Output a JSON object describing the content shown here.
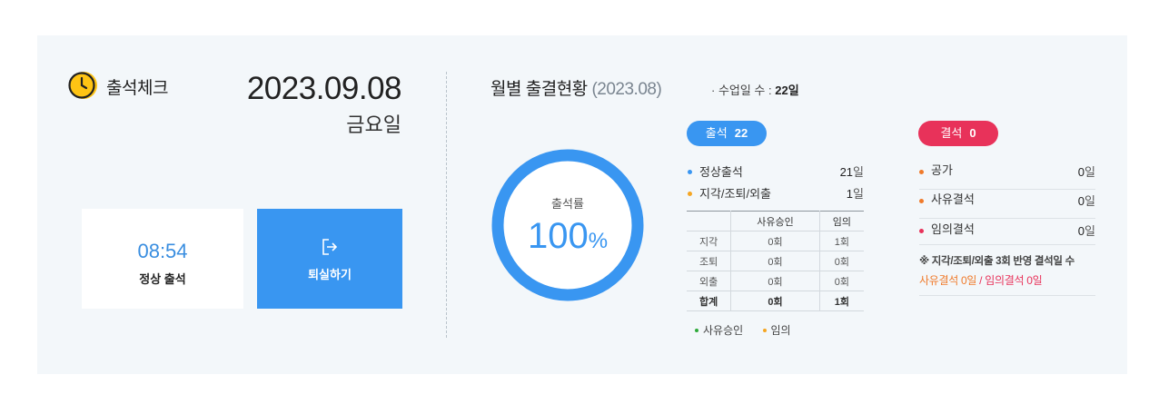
{
  "header": {
    "title": "출석체크",
    "date": "2023.09.08",
    "weekday": "금요일"
  },
  "checkin": {
    "time": "08:54",
    "status": "정상 출석",
    "leave_button": "퇴실하기"
  },
  "monthly": {
    "title": "월별 출결현황",
    "period": "(2023.08)",
    "class_days_label": "· 수업일 수 :",
    "class_days_value": "22일",
    "rate_label": "출석률",
    "rate_value": "100",
    "rate_unit": "%",
    "rate_fraction": 1.0,
    "attend_pill": {
      "label": "출석",
      "count": "22"
    },
    "attend_stats": [
      {
        "label": "정상출석",
        "value": "21",
        "unit": "일",
        "color": "#3996f1"
      },
      {
        "label": "지각/조퇴/외출",
        "value": "1",
        "unit": "일",
        "color": "#f5a623"
      }
    ],
    "table": {
      "headers": [
        "",
        "사유승인",
        "임의"
      ],
      "rows": [
        [
          "지각",
          "0회",
          "1회"
        ],
        [
          "조퇴",
          "0회",
          "0회"
        ],
        [
          "외출",
          "0회",
          "0회"
        ]
      ],
      "total": [
        "합계",
        "0회",
        "1회"
      ]
    },
    "legend": [
      {
        "label": "사유승인",
        "color": "#2eaa3a"
      },
      {
        "label": "임의",
        "color": "#f5a623"
      }
    ],
    "absent_pill": {
      "label": "결석",
      "count": "0"
    },
    "absent_stats": [
      {
        "label": "공가",
        "value": "0",
        "unit": "일",
        "color": "#f07a2a"
      },
      {
        "label": "사유결석",
        "value": "0",
        "unit": "일",
        "color": "#f07a2a"
      },
      {
        "label": "임의결석",
        "value": "0",
        "unit": "일",
        "color": "#e8325a"
      }
    ],
    "note_title": "※ 지각/조퇴/외출 3회 반영 결석일 수",
    "note_reason": "사유결석 0일",
    "note_sep": " / ",
    "note_arbitrary": "임의결석 0일"
  },
  "colors": {
    "accent": "#3996f1",
    "absent": "#e8325a",
    "panel_bg": "#f3f7fa",
    "clock": "#ffc414"
  },
  "icons": {
    "clock": "clock-icon",
    "leave": "logout-icon"
  }
}
